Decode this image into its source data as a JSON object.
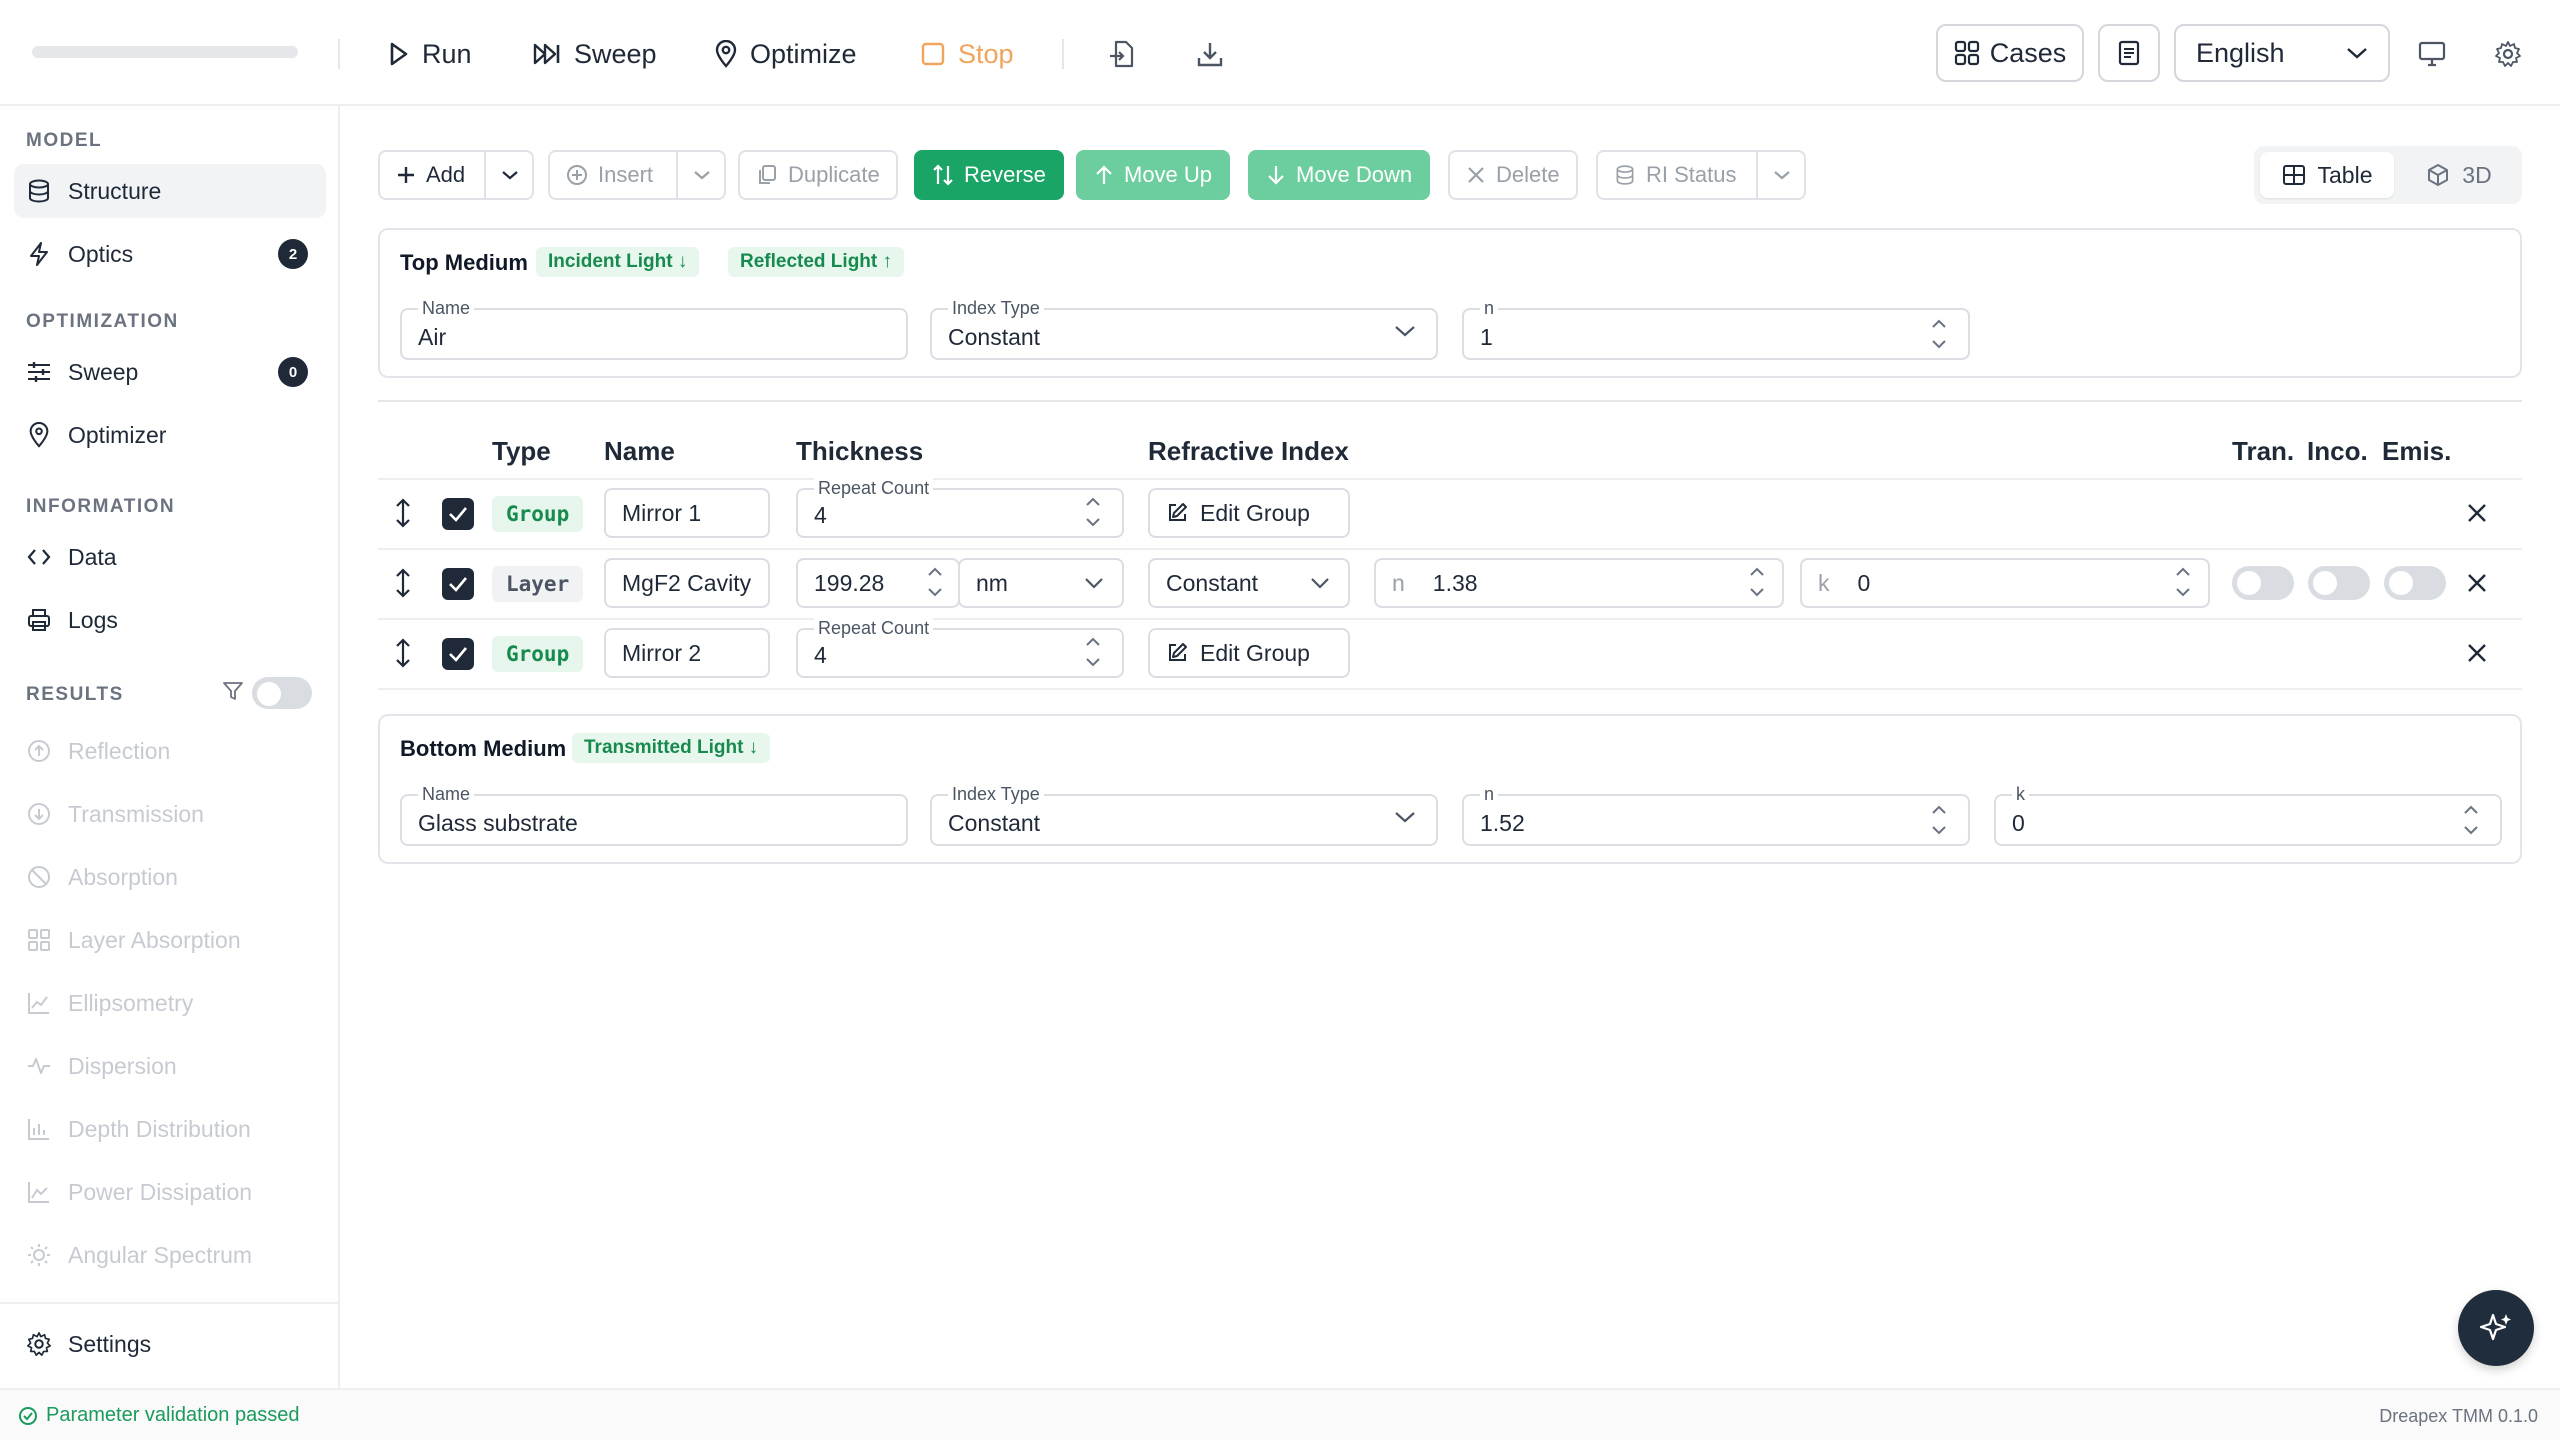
{
  "topbar": {
    "run": "Run",
    "sweep": "Sweep",
    "optimize": "Optimize",
    "stop": "Stop",
    "cases": "Cases",
    "language": "English"
  },
  "sidebar": {
    "model_header": "MODEL",
    "structure": "Structure",
    "optics": "Optics",
    "optics_count": "2",
    "optimization_header": "OPTIMIZATION",
    "sweep": "Sweep",
    "sweep_count": "0",
    "optimizer": "Optimizer",
    "information_header": "INFORMATION",
    "data": "Data",
    "logs": "Logs",
    "results_header": "RESULTS",
    "results": [
      "Reflection",
      "Transmission",
      "Absorption",
      "Layer Absorption",
      "Ellipsometry",
      "Dispersion",
      "Depth Distribution",
      "Power Dissipation",
      "Angular Spectrum"
    ],
    "settings": "Settings"
  },
  "toolbar": {
    "add": "Add",
    "insert": "Insert",
    "duplicate": "Duplicate",
    "reverse": "Reverse",
    "move_up": "Move Up",
    "move_down": "Move Down",
    "delete": "Delete",
    "ri_status": "RI Status",
    "view_table": "Table",
    "view_3d": "3D"
  },
  "top_medium": {
    "title": "Top Medium",
    "tag_incident": "Incident Light ↓",
    "tag_reflected": "Reflected Light ↑",
    "name_label": "Name",
    "name_value": "Air",
    "index_type_label": "Index Type",
    "index_type_value": "Constant",
    "n_label": "n",
    "n_value": "1"
  },
  "table": {
    "headers": {
      "type": "Type",
      "name": "Name",
      "thickness": "Thickness",
      "ri": "Refractive Index",
      "tran": "Tran.",
      "inco": "Inco.",
      "emis": "Emis."
    },
    "rows": [
      {
        "type": "Group",
        "name": "Mirror 1",
        "repeat_label": "Repeat Count",
        "repeat": "4",
        "action": "Edit Group"
      },
      {
        "type": "Layer",
        "name": "MgF2 Cavity",
        "thickness": "199.28",
        "unit": "nm",
        "index_type": "Constant",
        "n_label": "n",
        "n": "1.38",
        "k_label": "k",
        "k": "0"
      },
      {
        "type": "Group",
        "name": "Mirror 2",
        "repeat_label": "Repeat Count",
        "repeat": "4",
        "action": "Edit Group"
      }
    ]
  },
  "bottom_medium": {
    "title": "Bottom Medium",
    "tag_transmitted": "Transmitted Light ↓",
    "name_label": "Name",
    "name_value": "Glass substrate",
    "index_type_label": "Index Type",
    "index_type_value": "Constant",
    "n_label": "n",
    "n_value": "1.52",
    "k_label": "k",
    "k_value": "0"
  },
  "status": {
    "validation": "Parameter validation passed",
    "version": "Dreapex TMM 0.1.0"
  }
}
